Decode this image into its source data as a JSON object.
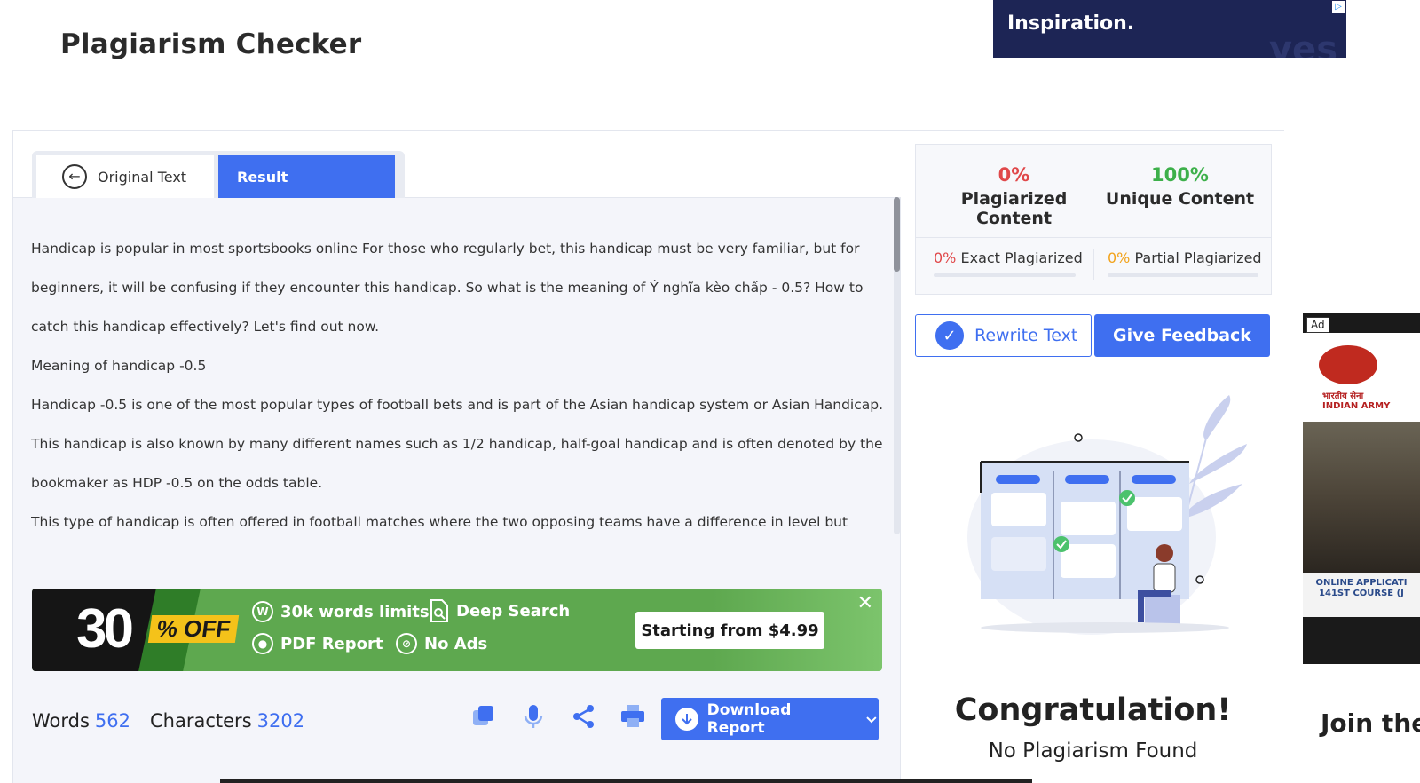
{
  "page": {
    "title": "Plagiarism Checker"
  },
  "top_ad": {
    "headline": "Inspiration.",
    "ghost_text": "yes"
  },
  "tabs": {
    "original_label": "Original Text",
    "result_label": "Result"
  },
  "content": {
    "paragraphs": [
      "Handicap is popular in most sportsbooks online For those who regularly bet, this handicap must be very familiar, but for beginners, it will be confusing if they encounter this handicap. So what is the meaning of Ý nghĩa kèo chấp - 0.5? How to catch this handicap effectively? Let's find out now.",
      "Meaning of handicap -0.5",
      "Handicap -0.5 is one of the most popular types of football bets and is part of the Asian handicap system or Asian Handicap. This handicap is also known by many different names such as 1/2 handicap, half-goal handicap and is often denoted by the bookmaker as HDP -0.5 on the odds table.",
      "This type of handicap is often offered in football matches where the two opposing teams have a difference in level but"
    ]
  },
  "promo": {
    "big_number": "30",
    "pct_off": "% OFF",
    "feature_1": "30k words limits",
    "feature_2": "Deep Search",
    "feature_3": "PDF Report",
    "feature_4": "No Ads",
    "cta": "Starting from $4.99",
    "close": "✕"
  },
  "stats": {
    "words_label": "Words",
    "words_value": "562",
    "chars_label": "Characters",
    "chars_value": "3202"
  },
  "download": {
    "label": "Download Report"
  },
  "scores": {
    "plagiarized_pct": "0%",
    "plagiarized_label": "Plagiarized Content",
    "unique_pct": "100%",
    "unique_label": "Unique Content",
    "exact_pct": "0%",
    "exact_label": "Exact Plagiarized",
    "partial_pct": "0%",
    "partial_label": "Partial Plagiarized"
  },
  "actions": {
    "rewrite_label": "Rewrite Text",
    "feedback_label": "Give Feedback"
  },
  "result": {
    "headline": "Congratulation!",
    "subline": "No Plagiarism Found"
  },
  "side_ad": {
    "tag": "Ad",
    "army_line_1": "भारतीय सेना",
    "army_line_2": "INDIAN ARMY",
    "info_line_1": "ONLINE APPLICATI",
    "info_line_2": "141ST COURSE (J",
    "join_text": "Join the"
  },
  "colors": {
    "accent": "#3f6ff0",
    "plagiarized": "#e0484a",
    "unique": "#3db04a",
    "partial": "#f2a31c",
    "promo_green": "#5ea84f"
  },
  "icons": [
    "arrow-left-icon",
    "copy-icon",
    "microphone-icon",
    "share-icon",
    "print-icon",
    "download-icon",
    "chevron-down-icon",
    "check-icon",
    "close-icon",
    "adchoices-icon"
  ]
}
